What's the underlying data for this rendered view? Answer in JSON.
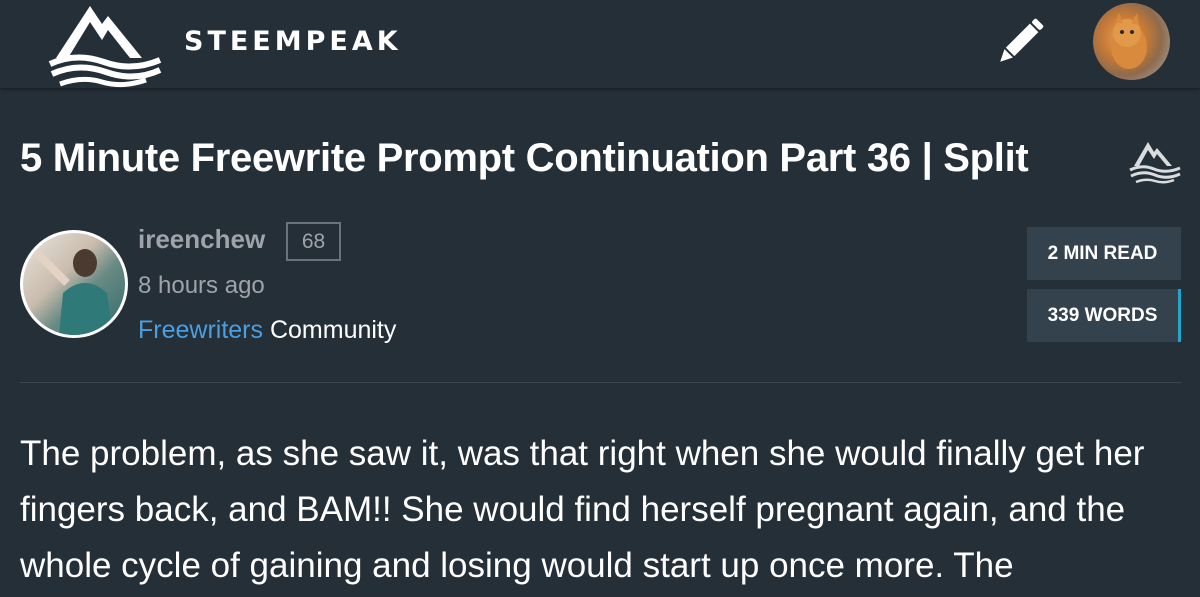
{
  "header": {
    "brand": "STEEMPEAK",
    "logo_icon": "steempeak-mountain-logo-icon",
    "edit_icon": "pencil-icon",
    "user_avatar": "user-avatar-cat"
  },
  "post": {
    "title": "5 Minute Freewrite Prompt Continuation Part 36 | Split",
    "title_icon": "steempeak-mountain-logo-icon",
    "author": {
      "name": "ireenchew",
      "reputation": "68",
      "time": "8 hours ago",
      "community_link": "Freewriters",
      "community_suffix": " Community"
    },
    "stats": {
      "read_time": "2 MIN READ",
      "word_count": "339 WORDS"
    },
    "body": "The problem, as she saw it, was that right when she would finally get her fingers back, and BAM!! She would find herself pregnant again, and the whole cycle of gaining and losing would start up once more. The"
  },
  "colors": {
    "background": "#252f38",
    "muted_text": "#9ea4aa",
    "link": "#4b9fe1",
    "stat_bg": "#34424e",
    "accent": "#1fa6c8"
  }
}
